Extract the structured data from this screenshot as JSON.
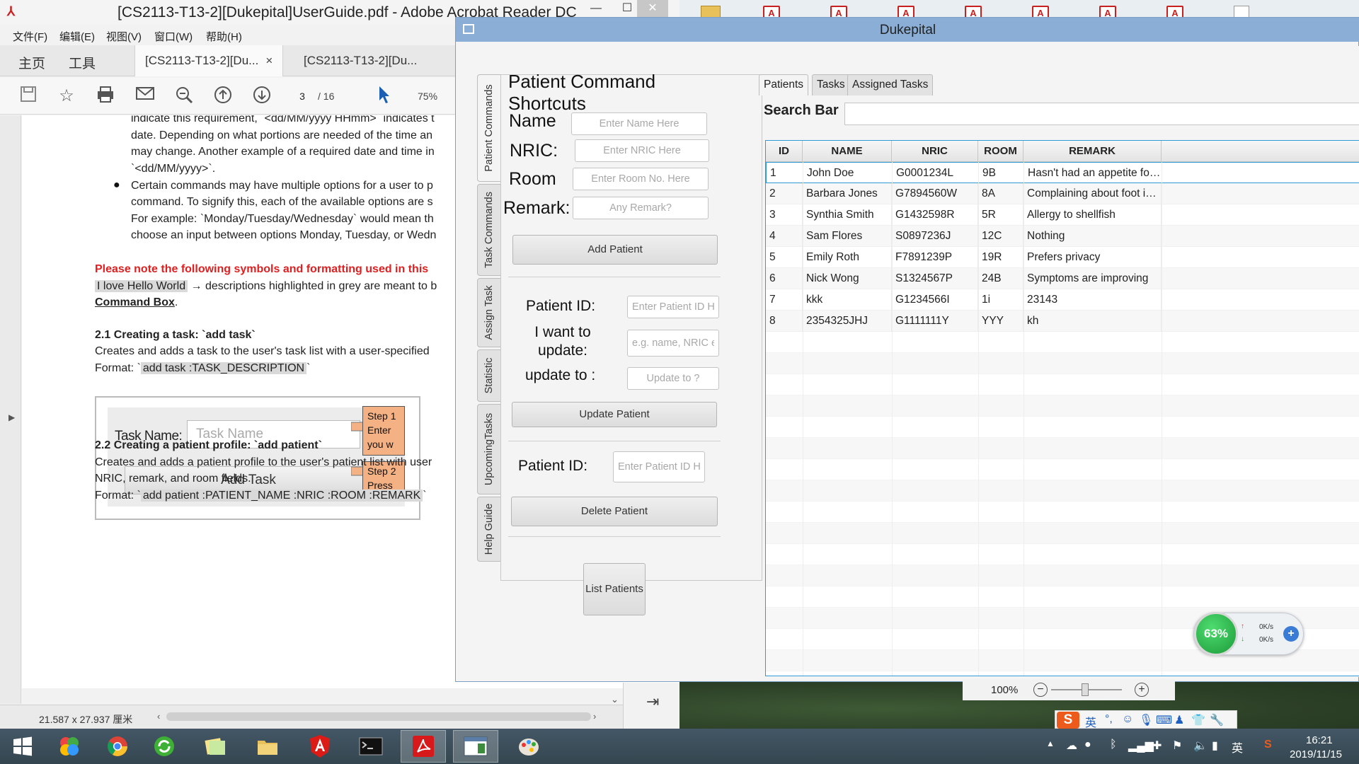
{
  "acrobat": {
    "title": "[CS2113-T13-2][Dukepital]UserGuide.pdf - Adobe Acrobat Reader DC",
    "window_controls": {
      "minimize": "—",
      "maximize": "☐",
      "close": "✕"
    },
    "menu": [
      "文件(F)",
      "编辑(E)",
      "视图(V)",
      "窗口(W)",
      "帮助(H)"
    ],
    "nav": {
      "home": "主页",
      "tools": "工具"
    },
    "tabs": [
      {
        "label": "[CS2113-T13-2][Du...",
        "close": "×"
      },
      {
        "label": "[CS2113-T13-2][Du..."
      }
    ],
    "toolbar": {
      "page_current": "3",
      "page_total": "/ 16",
      "zoom": "75%"
    },
    "status": {
      "page_size": "21.587 x 27.937 厘米"
    }
  },
  "document": {
    "lines": [
      "indicate this requirement, `<dd/MM/yyyy HHmm>` indicates t",
      "date. Depending on what portions are needed of the time an",
      "may change. Another example of a required date and time in",
      "`<dd/MM/yyyy>`.",
      "Certain commands may have multiple options for a user to p",
      "command. To signify this, each of the available options are s",
      "For example: `Monday/Tuesday/Wednesday` would mean th",
      "choose an input between options Monday, Tuesday, or Wedn"
    ],
    "note_red": "Please note the following symbols and formatting used in this",
    "grey_example": "I love Hello World",
    "grey_desc": "→ descriptions highlighted in grey are meant to b",
    "command_box": "Command Box",
    "command_box_suffix": ".",
    "sec21_title": "2.1 Creating a task: `add task`",
    "sec21_desc": "Creates and adds a task to the user's task list with a user-specified",
    "sec21_format_prefix": "Format: `",
    "sec21_format": "add task :TASK_DESCRIPTION",
    "sec21_format_suffix": "`",
    "figure": {
      "label": "Task Name:",
      "input_placeholder": "Task Name",
      "button": "Add Task",
      "step1_lines": [
        "Step 1",
        "Enter",
        "you w"
      ],
      "step2_lines": [
        "Step 2",
        "Press"
      ]
    },
    "sec22_title": "2.2 Creating a patient profile: `add patient`",
    "sec22_desc1": "Creates and adds a patient profile to the user's patient list with user",
    "sec22_desc2": "NRIC, remark, and room fields.",
    "sec22_format_prefix": "Format: `",
    "sec22_format": "add patient :PATIENT_NAME :NRIC :ROOM :REMARK",
    "sec22_format_suffix": "`"
  },
  "duke": {
    "title": "Dukepital",
    "vtabs": [
      "Patient Commands",
      "Task Commands",
      "Assign Task",
      "Statistic",
      "UpcomingTasks",
      "Help Guide"
    ],
    "shortcuts_title": "Patient Command Shortcuts",
    "labels": {
      "name": "Name",
      "nric": "NRIC:",
      "room": "Room",
      "remark": "Remark:"
    },
    "placeholders": {
      "name": "Enter Name Here",
      "nric": "Enter NRIC Here",
      "room": "Enter Room No. Here",
      "remark": "Any Remark?",
      "update_id": "Enter Patient ID Here",
      "update_field": "e.g. name, NRIC etc",
      "update_to": "Update to ?",
      "delete_id": "Enter Patient ID Here"
    },
    "buttons": {
      "add": "Add Patient",
      "update": "Update Patient",
      "delete": "Delete Patient",
      "list": "List Patients"
    },
    "update_labels": {
      "id": "Patient ID:",
      "want_line1": "I want to",
      "want_line2": "update:",
      "to": "update to :"
    },
    "delete_label": "Patient ID:",
    "htabs": [
      "Patients",
      "Tasks",
      "Assigned Tasks"
    ],
    "search_label": "Search Bar",
    "table": {
      "columns": [
        "ID",
        "NAME",
        "NRIC",
        "ROOM",
        "REMARK"
      ],
      "rows": [
        [
          "1",
          "John Doe",
          "G0001234L",
          "9B",
          "Hasn't had an appetite for past week"
        ],
        [
          "2",
          "Barbara Jones",
          "G7894560W",
          "8A",
          "Complaining about foot injury"
        ],
        [
          "3",
          "Synthia Smith",
          "G1432598R",
          "5R",
          "Allergy to shellfish"
        ],
        [
          "4",
          "Sam Flores",
          "S0897236J",
          "12C",
          "Nothing"
        ],
        [
          "5",
          "Emily Roth",
          "F7891239P",
          "19R",
          "Prefers privacy"
        ],
        [
          "6",
          "Nick Wong",
          "S1324567P",
          "24B",
          "Symptoms are improving"
        ],
        [
          "7",
          "kkk",
          "G1234566I",
          "1i",
          "23143"
        ],
        [
          "8",
          "2354325JHJ",
          "G1111111Y",
          "YYY",
          "kh"
        ]
      ]
    }
  },
  "speed_widget": {
    "percent": "63%",
    "up": "0K/s",
    "down": "0K/s"
  },
  "zoombar": {
    "zoom": "100%"
  },
  "ime": {
    "lang": "英"
  },
  "taskbar": {
    "time": "16:21",
    "date": "2019/11/15",
    "lang": "英"
  }
}
